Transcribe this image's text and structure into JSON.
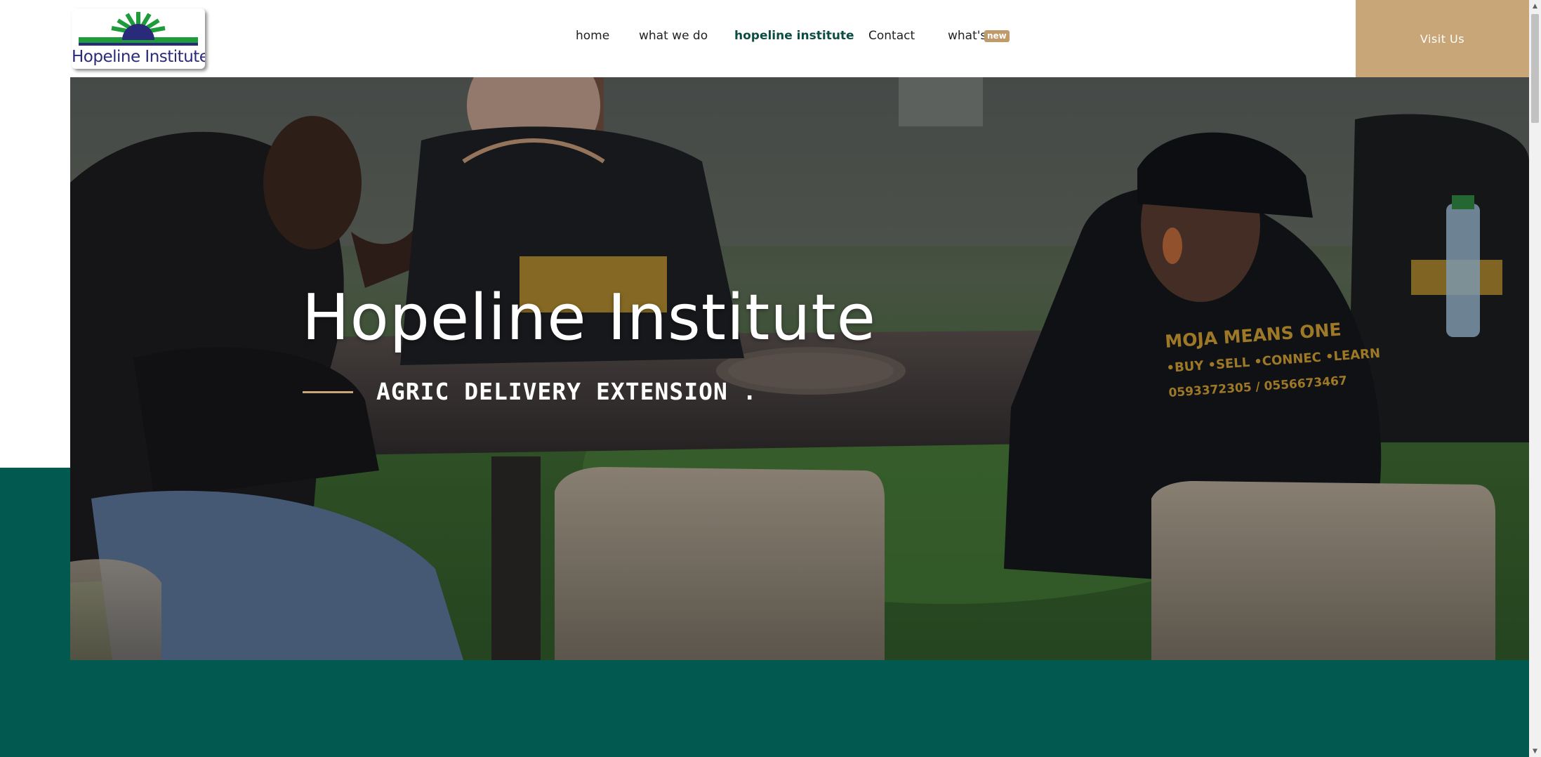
{
  "header": {
    "logo_text": "Hopeline Institute",
    "nav": [
      {
        "label": "home",
        "active": false
      },
      {
        "label": "what we do",
        "active": false
      },
      {
        "label": "hopeline institute",
        "active": true
      },
      {
        "label": "Contact",
        "active": false
      },
      {
        "label": "what's",
        "active": false,
        "badge": "new"
      }
    ],
    "visit_button": "Visit Us"
  },
  "hero": {
    "title": "Hopeline Institute",
    "subtitle": "AGRIC DELIVERY EXTENSION .",
    "photo_shirt_lines": [
      "MOJA MEANS ONE",
      "•BUY •SELL •CONNEC •LEARN",
      "0593372305 / 0556673467"
    ]
  },
  "colors": {
    "brand_green": "#02594f",
    "accent_tan": "#c8a677",
    "nav_active": "#0d4d44",
    "logo_green": "#1e9b3a",
    "logo_purple": "#2a2a7a"
  },
  "icons": {
    "logo_mark": "sunrise-icon",
    "scroll_up": "chevron-up-icon",
    "scroll_down": "chevron-down-icon"
  }
}
